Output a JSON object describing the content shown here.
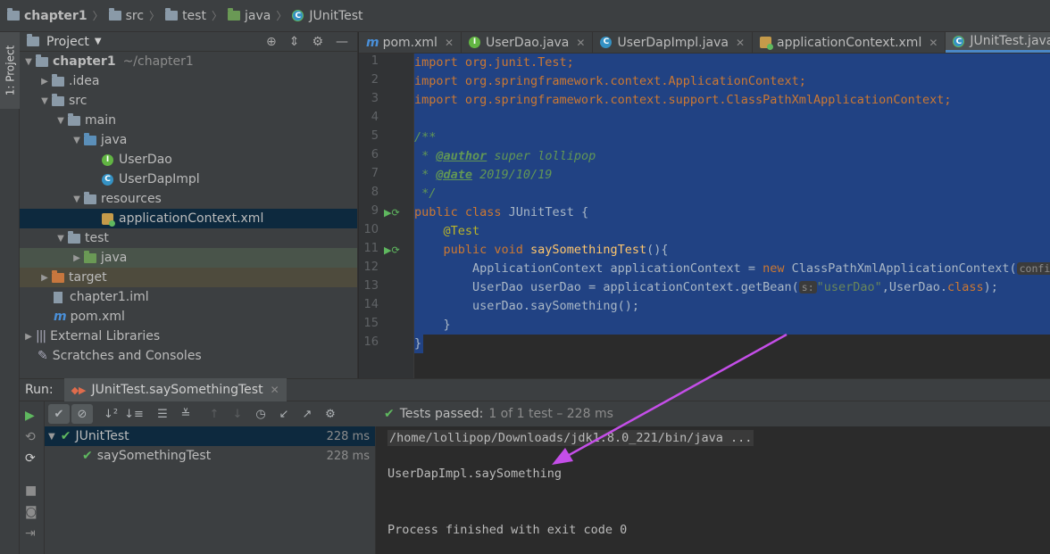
{
  "breadcrumb": {
    "items": [
      "chapter1",
      "src",
      "test",
      "java",
      "JUnitTest"
    ]
  },
  "side_tab": {
    "label": "1: Project"
  },
  "project_panel": {
    "title": "Project",
    "tree": [
      {
        "label": "chapter1",
        "extra": "~/chapter1"
      },
      {
        "label": ".idea"
      },
      {
        "label": "src"
      },
      {
        "label": "main"
      },
      {
        "label": "java"
      },
      {
        "label": "UserDao"
      },
      {
        "label": "UserDapImpl"
      },
      {
        "label": "resources"
      },
      {
        "label": "applicationContext.xml"
      },
      {
        "label": "test"
      },
      {
        "label": "java"
      },
      {
        "label": "target"
      },
      {
        "label": "chapter1.iml"
      },
      {
        "label": "pom.xml"
      },
      {
        "label": "External Libraries"
      },
      {
        "label": "Scratches and Consoles"
      }
    ]
  },
  "editor_tabs": [
    {
      "label": "pom.xml"
    },
    {
      "label": "UserDao.java"
    },
    {
      "label": "UserDapImpl.java"
    },
    {
      "label": "applicationContext.xml"
    },
    {
      "label": "JUnitTest.java"
    }
  ],
  "editor": {
    "line_numbers": [
      "1",
      "2",
      "3",
      "4",
      "5",
      "6",
      "7",
      "8",
      "9",
      "10",
      "11",
      "12",
      "13",
      "14",
      "15",
      "16"
    ],
    "code": {
      "l1": "import org.junit.Test;",
      "l2": "import org.springframework.context.ApplicationContext;",
      "l3": "import org.springframework.context.support.ClassPathXmlApplicationContext;",
      "l5": "/**",
      "l6_prefix": " * ",
      "l6_tag": "@author",
      "l6_text": " super lollipop",
      "l7_prefix": " * ",
      "l7_tag": "@date",
      "l7_text": " 2019/10/19",
      "l8": " */",
      "l9_kw": "public class",
      "l9_text": " JUnitTest {",
      "l10": "    @Test",
      "l11_kw": "    public void",
      "l11_fn": " saySomethingTest",
      "l11_text": "(){",
      "l12_a": "        ApplicationContext applicationContext = ",
      "l12_kw": "new",
      "l12_b": " ClassPathXmlApplicationContext(",
      "l12_hint": "configL",
      "l13_a": "        UserDao userDao = applicationContext.getBean(",
      "l13_hint": "s:",
      "l13_str": "\"userDao\"",
      "l13_b": ",UserDao.",
      "l13_kw": "class",
      "l13_c": ");",
      "l14": "        userDao.saySomething();",
      "l15": "    }",
      "l16": "}"
    }
  },
  "run_panel": {
    "label": "Run:",
    "tab": "JUnitTest.saySomethingTest",
    "status_main": "Tests passed:",
    "status_detail": "1 of 1 test – 228 ms",
    "tests": [
      {
        "name": "JUnitTest",
        "duration": "228 ms"
      },
      {
        "name": "saySomethingTest",
        "duration": "228 ms"
      }
    ],
    "console": {
      "command": "/home/lollipop/Downloads/jdk1.8.0_221/bin/java ...",
      "output": "UserDapImpl.saySomething",
      "exit": "Process finished with exit code 0"
    }
  },
  "colors": {
    "selection": "#214283",
    "annotation_arrow": "#c44ee8",
    "pass_green": "#5fb85f"
  }
}
